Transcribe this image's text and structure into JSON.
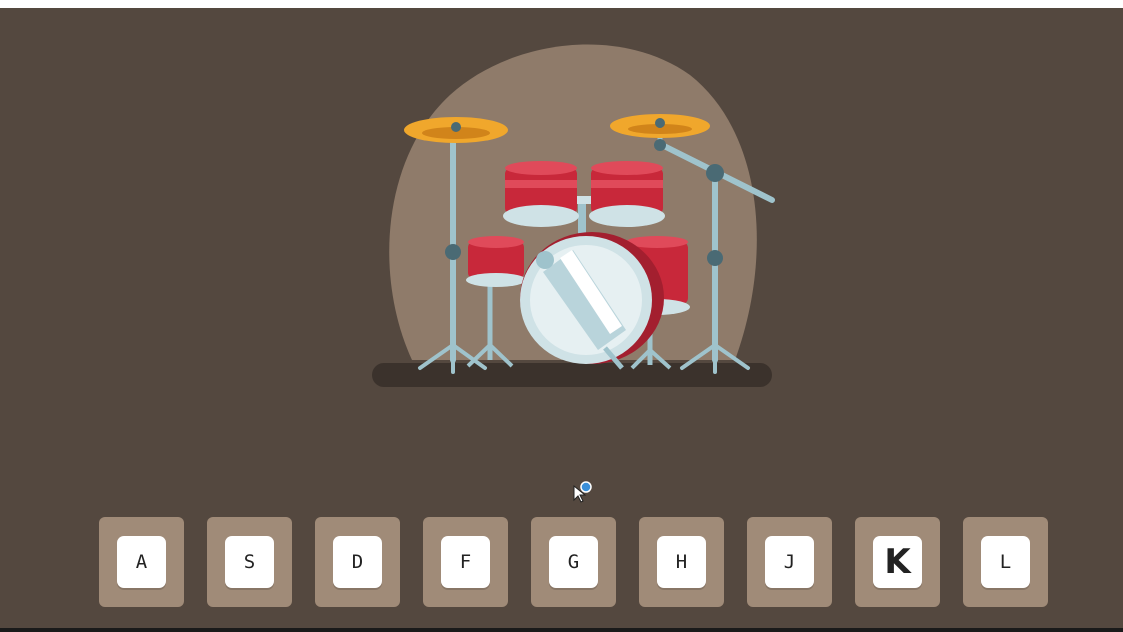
{
  "colors": {
    "background": "#54483f",
    "spotlight": "#8f7b6a",
    "key_tile": "#a08b78",
    "drum_red": "#c8283a",
    "cymbal": "#f0a72c"
  },
  "illustration": {
    "icon": "drum-kit-icon"
  },
  "keys": [
    {
      "label": "A",
      "active": false
    },
    {
      "label": "S",
      "active": false
    },
    {
      "label": "D",
      "active": false
    },
    {
      "label": "F",
      "active": false
    },
    {
      "label": "G",
      "active": false
    },
    {
      "label": "H",
      "active": false
    },
    {
      "label": "J",
      "active": false
    },
    {
      "label": "K",
      "active": true
    },
    {
      "label": "L",
      "active": false
    }
  ]
}
